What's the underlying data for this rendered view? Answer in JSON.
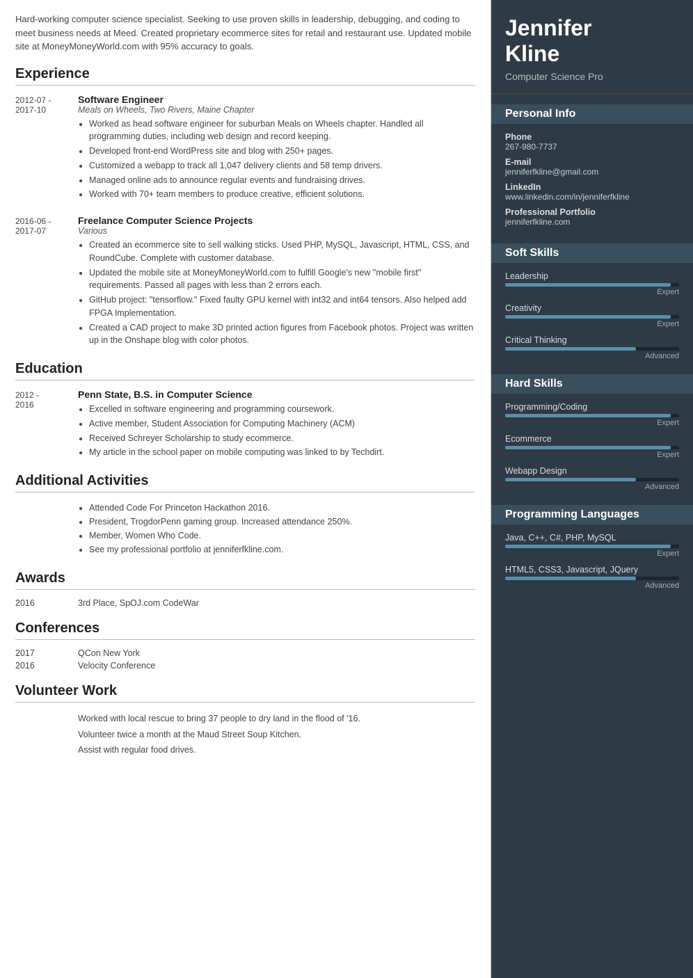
{
  "summary": "Hard-working computer science specialist. Seeking to use proven skills in leadership, debugging, and coding to meet business needs at Meed. Created proprietary ecommerce sites for retail and restaurant use. Updated mobile site at MoneyMoneyWorld.com with 95% accuracy to goals.",
  "sections": {
    "experience_label": "Experience",
    "education_label": "Education",
    "activities_label": "Additional Activities",
    "awards_label": "Awards",
    "conferences_label": "Conferences",
    "volunteer_label": "Volunteer Work"
  },
  "experience": [
    {
      "start": "2012-07 -",
      "end": "2017-10",
      "title": "Software Engineer",
      "org": "Meals on Wheels, Two Rivers, Maine Chapter",
      "bullets": [
        "Worked as head software engineer for suburban Meals on Wheels chapter. Handled all programming duties, including web design and record keeping.",
        "Developed front-end WordPress site and blog with 250+ pages.",
        "Customized a webapp to track all 1,047 delivery clients and 58 temp drivers.",
        "Managed online ads to announce regular events and fundraising drives.",
        "Worked with 70+ team members to produce creative, efficient solutions."
      ]
    },
    {
      "start": "2016-06 -",
      "end": "2017-07",
      "title": "Freelance Computer Science Projects",
      "org": "Various",
      "bullets": [
        "Created an ecommerce site to sell walking sticks. Used PHP, MySQL, Javascript, HTML, CSS, and RoundCube. Complete with customer database.",
        "Updated the mobile site at MoneyMoneyWorld.com to fulfill Google's new \"mobile first\" requirements. Passed all pages with less than 2 errors each.",
        "GitHub project: \"tensorflow.\" Fixed faulty GPU kernel with int32 and int64 tensors. Also helped add FPGA Implementation.",
        "Created a CAD project to make 3D printed action figures from Facebook photos. Project was written up in the Onshape blog with color photos."
      ]
    }
  ],
  "education": [
    {
      "start": "2012 -",
      "end": "2016",
      "title": "Penn State, B.S. in Computer Science",
      "bullets": [
        "Excelled in software engineering and programming coursework.",
        "Active member, Student Association for Computing Machinery (ACM)",
        "Received Schreyer Scholarship to study ecommerce.",
        "My article in the school paper on mobile computing was linked to by Techdirt."
      ]
    }
  ],
  "activities": [
    "Attended Code For Princeton Hackathon 2016.",
    "President, TrogdorPenn gaming group. Increased attendance 250%.",
    "Member, Women Who Code.",
    "See my professional portfolio at jenniferfkline.com."
  ],
  "awards": [
    {
      "year": "2016",
      "text": "3rd Place, SpOJ.com CodeWar"
    }
  ],
  "conferences": [
    {
      "year": "2017",
      "text": "QCon New York"
    },
    {
      "year": "2016",
      "text": "Velocity Conference"
    }
  ],
  "volunteer": [
    "Worked with local rescue to bring 37 people to dry land in the flood of '16.",
    "Volunteer twice a month at the Maud Street Soup Kitchen.",
    "Assist with regular food drives."
  ],
  "right": {
    "name_line1": "Jennifer",
    "name_line2": "Kline",
    "title": "Computer Science Pro",
    "personal_info_label": "Personal Info",
    "phone_label": "Phone",
    "phone_value": "267-980-7737",
    "email_label": "E-mail",
    "email_value": "jenniferfkline@gmail.com",
    "linkedin_label": "LinkedIn",
    "linkedin_value": "www.linkedin.com/in/jenniferfkline",
    "portfolio_label": "Professional Portfolio",
    "portfolio_value": "jenniferfkline.com",
    "soft_skills_label": "Soft Skills",
    "hard_skills_label": "Hard Skills",
    "prog_lang_label": "Programming Languages",
    "soft_skills": [
      {
        "name": "Leadership",
        "pct": 95,
        "level": "Expert"
      },
      {
        "name": "Creativity",
        "pct": 95,
        "level": "Expert"
      },
      {
        "name": "Critical Thinking",
        "pct": 75,
        "level": "Advanced"
      }
    ],
    "hard_skills": [
      {
        "name": "Programming/Coding",
        "pct": 95,
        "level": "Expert"
      },
      {
        "name": "Ecommerce",
        "pct": 95,
        "level": "Expert"
      },
      {
        "name": "Webapp Design",
        "pct": 75,
        "level": "Advanced"
      }
    ],
    "prog_langs": [
      {
        "name": "Java, C++, C#, PHP, MySQL",
        "pct": 95,
        "level": "Expert"
      },
      {
        "name": "HTML5, CSS3, Javascript, JQuery",
        "pct": 75,
        "level": "Advanced"
      }
    ]
  }
}
